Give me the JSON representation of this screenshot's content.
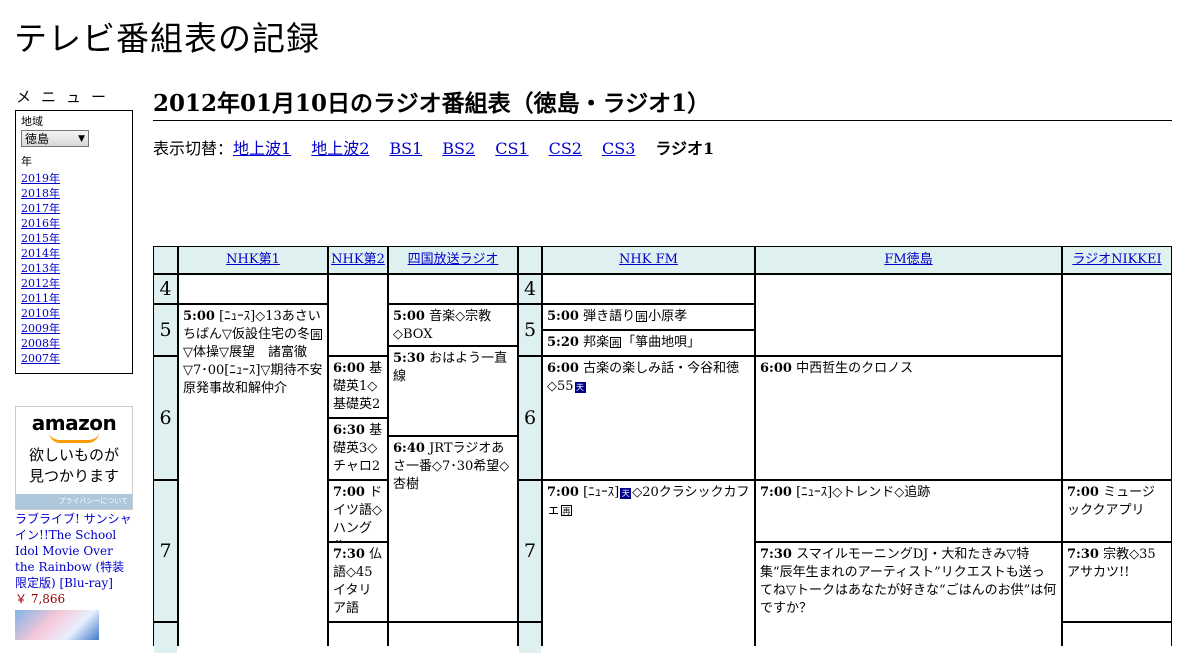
{
  "site": {
    "title": "テレビ番組表の記録"
  },
  "menu": {
    "title": "メニュー",
    "region_label": "地域",
    "region_value": "徳島",
    "year_label": "年",
    "years": [
      "2019年",
      "2018年",
      "2017年",
      "2016年",
      "2015年",
      "2014年",
      "2013年",
      "2012年",
      "2011年",
      "2010年",
      "2009年",
      "2008年",
      "2007年"
    ]
  },
  "ad": {
    "logo": "amazon",
    "tagline_1": "欲しいものが",
    "tagline_2": "見つかります",
    "privacy": "プライバシーについて",
    "product_title": "ラブライブ! サンシャイン!!The School Idol Movie Over the Rainbow (特装限定版) [Blu-ray]",
    "product_price": "￥ 7,866"
  },
  "page": {
    "heading": "2012年01月10日のラジオ番組表（徳島・ラジオ1）"
  },
  "switcher": {
    "label": "表示切替：",
    "links": [
      "地上波1",
      "地上波2",
      "BS1",
      "BS2",
      "CS1",
      "CS2",
      "CS3"
    ],
    "current": "ラジオ1"
  },
  "grid": {
    "channels": [
      "NHK第1",
      "NHK第2",
      "四国放送ラジオ",
      "NHK FM",
      "FM徳島",
      "ラジオNIKKEI"
    ],
    "hours": [
      "4",
      "5",
      "6",
      "7"
    ],
    "programs": {
      "nhk1_500": {
        "time": "5:00",
        "a": "[ﾆｭｰｽ]◇13あさいちばん▽仮設住宅の冬",
        "b": "▽体操▽展望　諸富徹▽7･00[ﾆｭｰｽ]▽期待不安原発事故和解仲介",
        "mark": "再"
      },
      "nhk2_600": {
        "time": "6:00",
        "text": "基礎英1◇基礎英2"
      },
      "nhk2_630": {
        "time": "6:30",
        "text": "基礎英3◇チャロ2"
      },
      "nhk2_700": {
        "time": "7:00",
        "text": "ドイツ語◇ハングル"
      },
      "nhk2_730": {
        "time": "7:30",
        "text": "仏語◇45イタリア語"
      },
      "shikoku_500": {
        "time": "5:00",
        "text": "音楽◇宗教◇BOX"
      },
      "shikoku_530": {
        "time": "5:30",
        "text": "おはよう一直線"
      },
      "shikoku_640": {
        "time": "6:40",
        "text": "JRTラジオあさ一番◇7･30希望◇杏樹"
      },
      "fm_500": {
        "time": "5:00",
        "a": "弾き語り",
        "b": "小原孝",
        "mark": "再"
      },
      "fm_520": {
        "time": "5:20",
        "a": "邦楽",
        "b": "「箏曲地唄」",
        "mark": "再"
      },
      "fm_600": {
        "time": "6:00",
        "a": "古楽の楽しみ話・今谷和徳◇55",
        "mark": "天"
      },
      "fm_700": {
        "time": "7:00",
        "a": "[ﾆｭｰｽ]",
        "b": "◇20クラシックカフェ",
        "mark_1": "天",
        "mark_2": "再"
      },
      "fmt_600": {
        "time": "6:00",
        "text": "中西哲生のクロノス"
      },
      "fmt_700": {
        "time": "7:00",
        "text": "[ﾆｭｰｽ]◇トレンド◇追跡"
      },
      "fmt_730": {
        "time": "7:30",
        "text": "スマイルモーニングDJ・大和たきみ▽特集“辰年生まれのアーティスト”リクエストも送ってね▽トークはあなたが好きな“ごはんのお供”は何ですか？"
      },
      "nikkei_700": {
        "time": "7:00",
        "text": "ミュージッククアプリ"
      },
      "nikkei_730": {
        "time": "7:30",
        "text": "宗教◇35アサカツ!!"
      }
    }
  }
}
